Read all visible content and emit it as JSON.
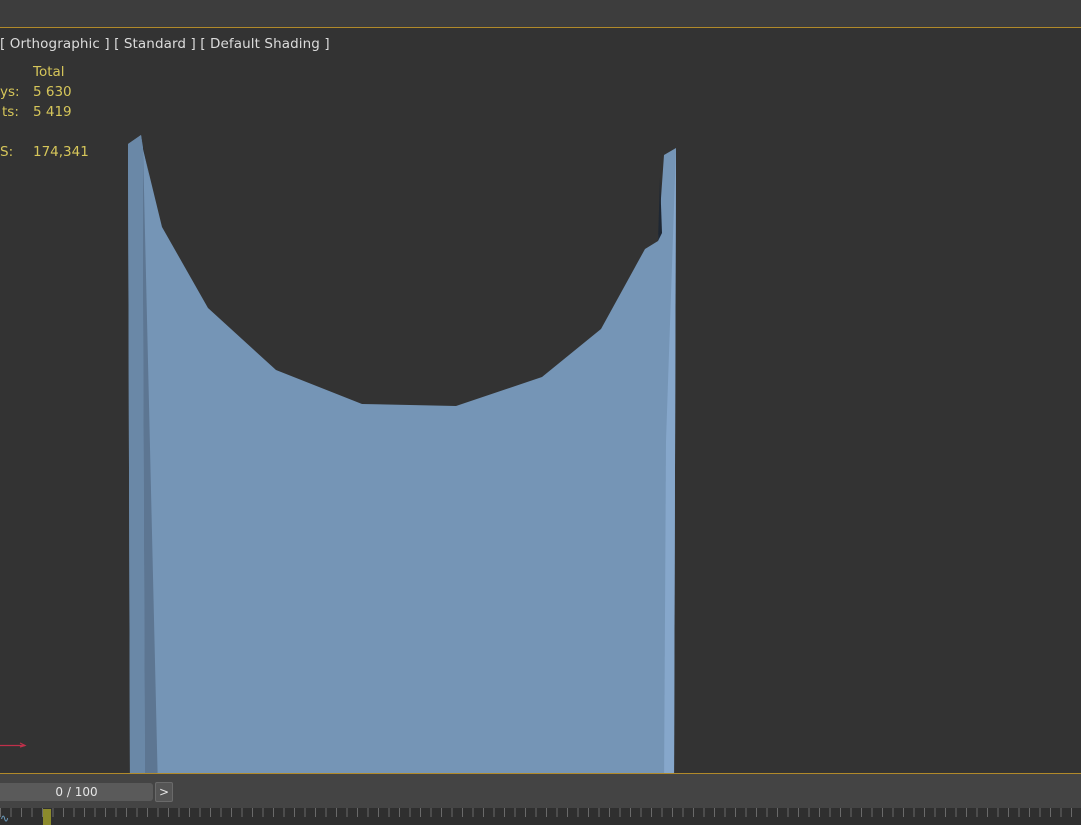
{
  "viewport": {
    "labels": [
      "[ Orthographic ]",
      "[ Standard ]",
      "[ Default Shading ]"
    ]
  },
  "stats": {
    "header": "Total",
    "rows": [
      {
        "label": "ys:",
        "value": "5 630"
      },
      {
        "label": "ts:",
        "value": "5 419"
      },
      {
        "label": "S:",
        "value": "174,341"
      }
    ]
  },
  "timeline": {
    "frame": "0 / 100",
    "next_label": ">"
  },
  "icons": {
    "curve": "curve-editor-icon",
    "axis": "axis-tripod-icon"
  },
  "colors": {
    "viewport_bg": "#333333",
    "border_accent": "#b18a2a",
    "stats_text": "#d6c65a",
    "mesh_main": "#7595b6",
    "mesh_shadow": "#5d7692"
  }
}
